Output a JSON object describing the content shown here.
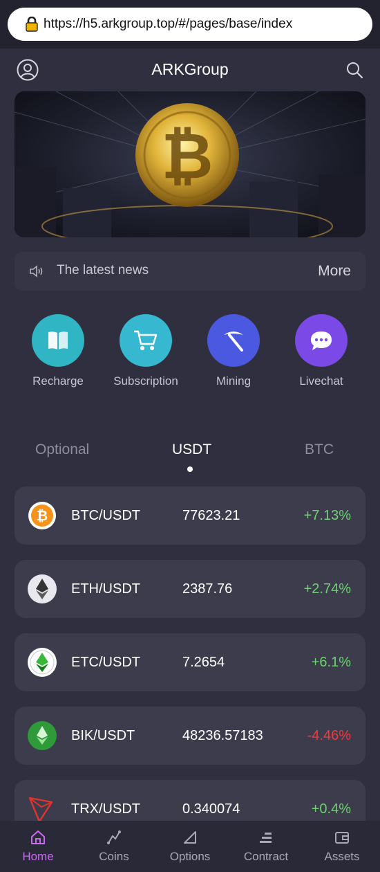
{
  "browser": {
    "url": "https://h5.arkgroup.top/#/pages/base/index"
  },
  "header": {
    "title": "ARKGroup"
  },
  "news": {
    "label": "The latest news",
    "more": "More"
  },
  "quick_actions": [
    {
      "label": "Recharge",
      "color": "#2fb5c4"
    },
    {
      "label": "Subscription",
      "color": "#36b8d0"
    },
    {
      "label": "Mining",
      "color": "#4b58e0"
    },
    {
      "label": "Livechat",
      "color": "#7b49e6"
    }
  ],
  "market_tabs": [
    "Optional",
    "USDT",
    "BTC"
  ],
  "market_active_tab": "USDT",
  "coins": [
    {
      "pair": "BTC/USDT",
      "price": "77623.21",
      "change": "+7.13%",
      "trend": "up",
      "icon": "bitcoin-icon"
    },
    {
      "pair": "ETH/USDT",
      "price": "2387.76",
      "change": "+2.74%",
      "trend": "up",
      "icon": "ethereum-icon"
    },
    {
      "pair": "ETC/USDT",
      "price": "7.2654",
      "change": "+6.1%",
      "trend": "up",
      "icon": "ethereum-classic-icon"
    },
    {
      "pair": "BIK/USDT",
      "price": "48236.57183",
      "change": "-4.46%",
      "trend": "down",
      "icon": "bik-icon"
    },
    {
      "pair": "TRX/USDT",
      "price": "0.340074",
      "change": "+0.4%",
      "trend": "up",
      "icon": "tron-icon"
    }
  ],
  "colors": {
    "up": "#6fd173",
    "down": "#ee3b3b",
    "active_nav": "#c86cf0",
    "inactive_nav": "#a9a8b6"
  },
  "bottom_nav": [
    {
      "label": "Home",
      "icon": "home-icon",
      "active": true
    },
    {
      "label": "Coins",
      "icon": "coins-icon",
      "active": false
    },
    {
      "label": "Options",
      "icon": "options-icon",
      "active": false
    },
    {
      "label": "Contract",
      "icon": "contract-icon",
      "active": false
    },
    {
      "label": "Assets",
      "icon": "wallet-icon",
      "active": false
    }
  ]
}
